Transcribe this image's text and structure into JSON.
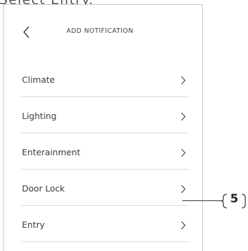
{
  "caption": "Select Entry.",
  "header": {
    "title": "ADD NOTIFICATION",
    "back_icon": "chevron-left-icon"
  },
  "menu": {
    "items": [
      {
        "label": "Climate",
        "icon": "chevron-right-icon"
      },
      {
        "label": "Lighting",
        "icon": "chevron-right-icon"
      },
      {
        "label": "Enterainment",
        "icon": "chevron-right-icon"
      },
      {
        "label": "Door Lock",
        "icon": "chevron-right-icon"
      },
      {
        "label": "Entry",
        "icon": "chevron-right-icon"
      }
    ]
  },
  "callout": {
    "number": "5"
  },
  "colors": {
    "text": "#3a3a3a",
    "divider": "#d9d9d9",
    "frame": "#c8c8c8"
  }
}
